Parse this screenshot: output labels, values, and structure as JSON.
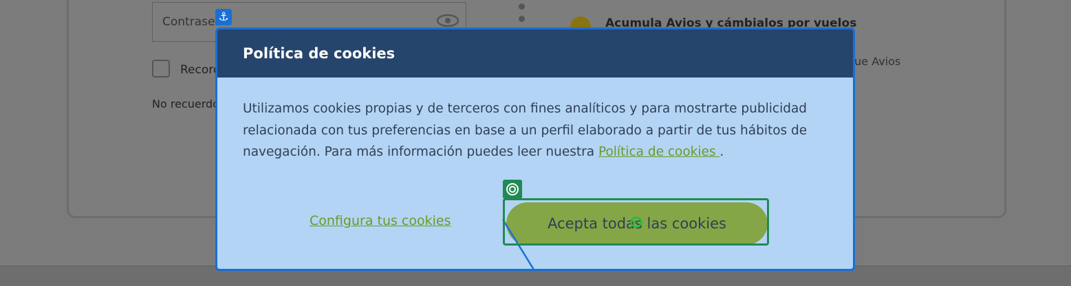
{
  "background": {
    "password_placeholder": "Contraseña",
    "remember_label": "Recordarme",
    "forgot_text": "No recuerdo mi contraseña",
    "avios_heading": "Acumula Avios y cámbialos por vuelos",
    "avios_text": "que Avios"
  },
  "modal": {
    "title": "Política de cookies",
    "body_text": "Utilizamos cookies propias y de terceros con fines analíticos y para mostrarte publicidad relacionada con tus preferencias en base a un perfil elaborado a partir de tus hábitos de navegación. Para más información puedes leer nuestra ",
    "policy_link": "Política de cookies ",
    "body_end": ".",
    "configure_label": "Configura tus cookies",
    "accept_label": "Acepta todas las cookies"
  },
  "colors": {
    "header_bg": "#26456c",
    "modal_bg": "#b4d4f5",
    "accent_green": "#84a646",
    "link_green": "#6a9a2a",
    "overlay_blue": "#1a6fd6",
    "target_green": "#1f8a52"
  },
  "icons": {
    "anchor": "anchor-icon",
    "target": "target-icon",
    "eye": "eye-icon"
  }
}
